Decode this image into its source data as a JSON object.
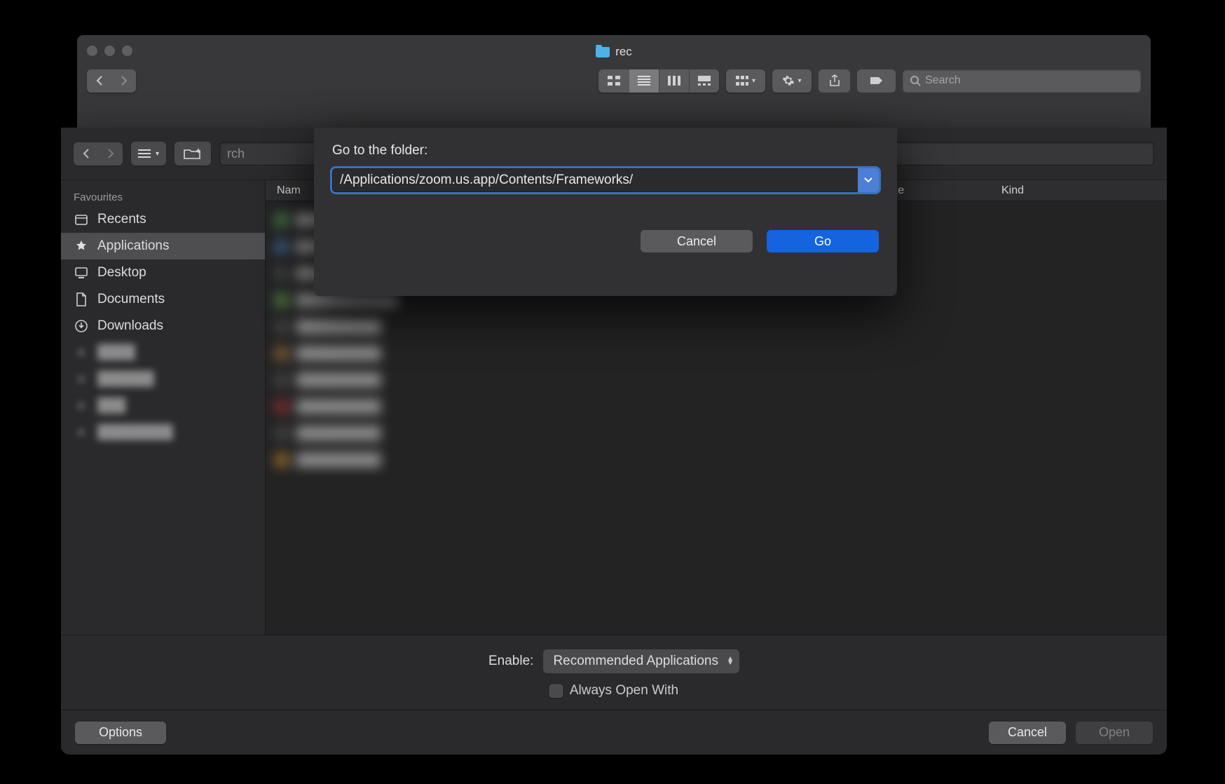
{
  "finder": {
    "title": "rec",
    "search_placeholder": "Search"
  },
  "open_panel": {
    "search_placeholder": "rch",
    "sidebar": {
      "section": "Favourites",
      "items": [
        {
          "icon": "clock",
          "label": "Recents",
          "selected": false
        },
        {
          "icon": "apps",
          "label": "Applications",
          "selected": true
        },
        {
          "icon": "desktop",
          "label": "Desktop",
          "selected": false
        },
        {
          "icon": "doc",
          "label": "Documents",
          "selected": false
        },
        {
          "icon": "download",
          "label": "Downloads",
          "selected": false
        }
      ]
    },
    "columns": {
      "name": "Nam",
      "modified": "",
      "size": "Size",
      "kind": "Kind"
    },
    "enable_label": "Enable:",
    "enable_value": "Recommended Applications",
    "always_open_label": "Always Open With",
    "options_label": "Options",
    "cancel_label": "Cancel",
    "open_label": "Open"
  },
  "goto": {
    "title": "Go to the folder:",
    "path": "/Applications/zoom.us.app/Contents/Frameworks/",
    "cancel_label": "Cancel",
    "go_label": "Go"
  }
}
